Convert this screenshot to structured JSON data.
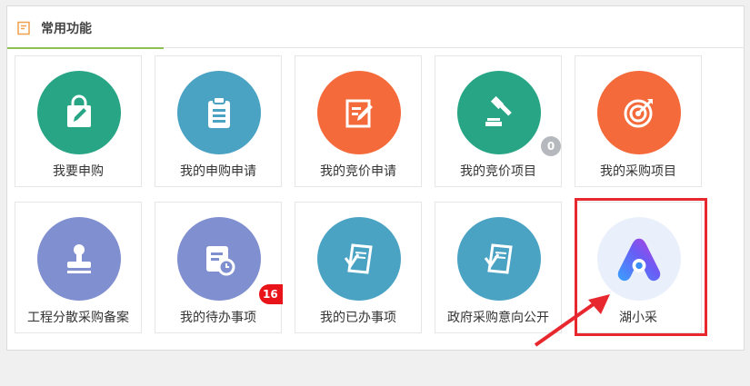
{
  "panel": {
    "title": "常用功能"
  },
  "tiles": [
    {
      "label": "我要申购",
      "icon": "shopping-bag-edit-icon",
      "color": "#27a585"
    },
    {
      "label": "我的申购申请",
      "icon": "clipboard-list-icon",
      "color": "#4ba3c4"
    },
    {
      "label": "我的竞价申请",
      "icon": "edit-note-icon",
      "color": "#f46a3b"
    },
    {
      "label": "我的竞价项目",
      "icon": "gavel-icon",
      "color": "#27a585",
      "badge": "0"
    },
    {
      "label": "我的采购项目",
      "icon": "target-icon",
      "color": "#f46a3b"
    },
    {
      "label": "工程分散采购备案",
      "icon": "stamp-icon",
      "color": "#7f8fcf"
    },
    {
      "label": "我的待办事项",
      "icon": "calendar-clock-icon",
      "color": "#7f8fcf",
      "badge": "16"
    },
    {
      "label": "我的已办事项",
      "icon": "document-check-icon",
      "color": "#4ba3c4"
    },
    {
      "label": "政府采购意向公开",
      "icon": "document-check-icon",
      "color": "#4ba3c4"
    },
    {
      "label": "湖小采",
      "icon": "hu-xiao-cai-logo-icon",
      "color": "#eaf0fb"
    }
  ],
  "colors": {
    "highlight": "#e8282f",
    "accent": "#8cc152",
    "badge_red": "#e8141a",
    "badge_gray": "#b5b9bd"
  }
}
